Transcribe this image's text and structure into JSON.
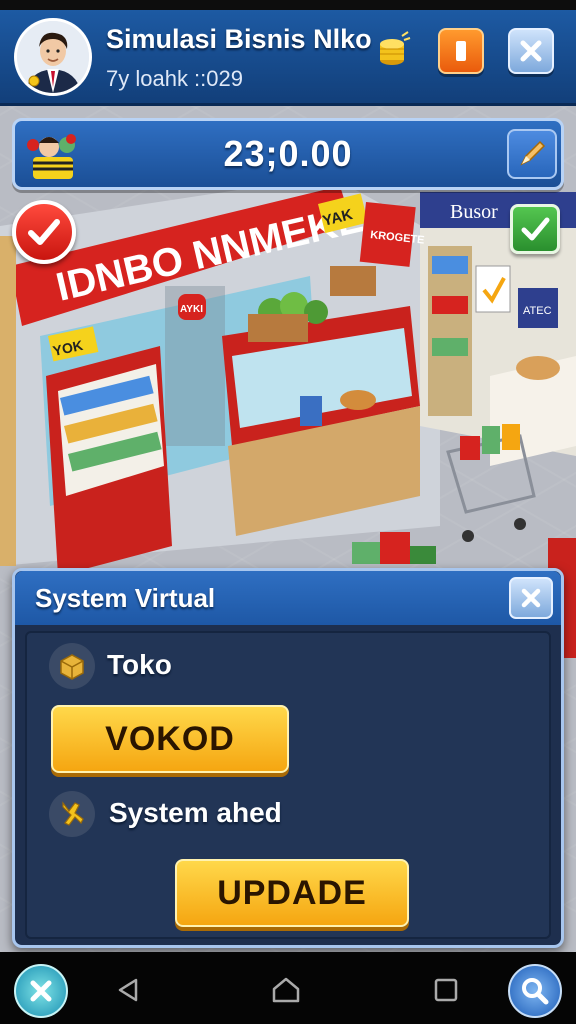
{
  "header": {
    "title": "Simulasi Bisnis  Nlko",
    "subtitle": "7y loahk ::029",
    "avatar_icon": "businessman-avatar-icon",
    "coin_icon": "coin-stack-icon",
    "pause_icon": "pause-icon",
    "close_icon": "close-icon"
  },
  "money": {
    "value": "23;0.00",
    "shop_icon": "shopkeeper-icon",
    "edit_icon": "pencil-icon"
  },
  "scene": {
    "store_sign": "IDNBO NNMEKE",
    "sign_tag_left": "YOK",
    "sign_tag_right": "YAK",
    "side_sign": "Busor",
    "side_sign_2": "KROGETE",
    "window_tag": "AYKI",
    "shelf_tag": "YOK",
    "poster_text": "ATEC"
  },
  "dialog": {
    "title": "System Virtual",
    "row1_label": "Toko",
    "row1_icon": "crate-icon",
    "button1_label": "VOKOD",
    "row2_label": "System ahed",
    "row2_icon": "wrench-icon",
    "button2_label": "UPDADE"
  },
  "navbar": {
    "left_icon": "close-round-icon",
    "back_icon": "back-icon",
    "home_icon": "home-icon",
    "recent_icon": "recent-apps-icon",
    "search_icon": "search-icon"
  },
  "colors": {
    "header_blue": "#1d5aa3",
    "dialog_bg": "#1e2f4e",
    "button_yellow": "#f5a611",
    "pause_orange": "#ea5b0c",
    "check_red": "#e02424",
    "check_green": "#36a83a"
  }
}
